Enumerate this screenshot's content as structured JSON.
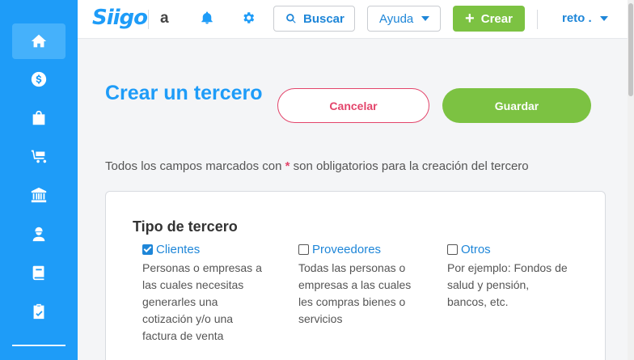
{
  "brand": {
    "logo": "Siigo",
    "accent": "#1e9cf8",
    "green": "#7cc242",
    "danger": "#e3456b"
  },
  "sidebar": {
    "items": [
      {
        "icon": "home-icon",
        "active": true
      },
      {
        "icon": "dollar-icon",
        "active": false
      },
      {
        "icon": "shopping-bag-icon",
        "active": false
      },
      {
        "icon": "cart-icon",
        "active": false
      },
      {
        "icon": "bank-icon",
        "active": false
      },
      {
        "icon": "user-worker-icon",
        "active": false
      },
      {
        "icon": "book-icon",
        "active": false
      },
      {
        "icon": "clipboard-check-icon",
        "active": false
      }
    ]
  },
  "topbar": {
    "company": "a",
    "search_label": "Buscar",
    "help_label": "Ayuda",
    "create_label": "Crear",
    "user_label": "reto ."
  },
  "page": {
    "title": "Crear un tercero",
    "cancel_label": "Cancelar",
    "save_label": "Guardar",
    "note_before": "Todos los campos marcados con",
    "note_star": "*",
    "note_after": "son obligatorios para la creación del tercero"
  },
  "tercero": {
    "title": "Tipo de tercero",
    "options": [
      {
        "label": "Clientes",
        "checked": true,
        "description": "Personas o empresas a\nlas cuales necesitas\ngenerarles una\ncotización y/o una\nfactura de venta"
      },
      {
        "label": "Proveedores",
        "checked": false,
        "description": "Todas las personas o\nempresas a las cuales\nles compras bienes o\nservicios"
      },
      {
        "label": "Otros",
        "checked": false,
        "description": "Por ejemplo: Fondos de\nsalud y pensión,\nbancos, etc."
      }
    ]
  }
}
